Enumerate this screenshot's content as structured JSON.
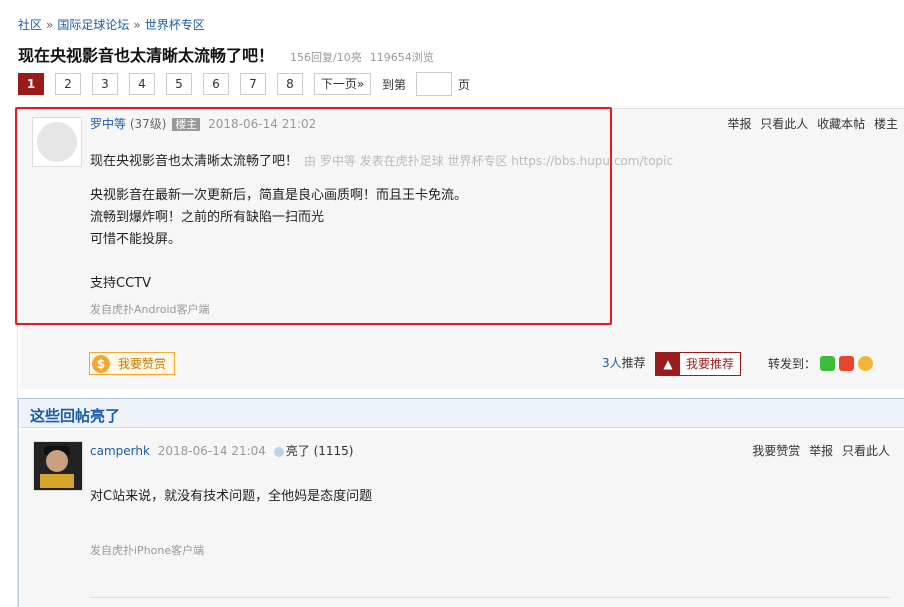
{
  "breadcrumb": {
    "items": [
      "社区",
      "国际足球论坛",
      "世界杯专区"
    ],
    "sep": "»"
  },
  "thread": {
    "title": "现在央视影音也太清晰太流畅了吧！",
    "replies": "156回复",
    "lights": "/10亮",
    "views": "119654浏览"
  },
  "pager": {
    "pages": [
      "1",
      "2",
      "3",
      "4",
      "5",
      "6",
      "7",
      "8"
    ],
    "next": "下一页»",
    "goto_prefix": "到第",
    "goto_suffix": "页"
  },
  "post": {
    "username": "罗中等",
    "level": "(37级)",
    "owner_badge": "楼主",
    "date": "2018-06-14 21:02",
    "actions": [
      "举报",
      "只看此人",
      "收藏本帖",
      "楼主"
    ],
    "headline": "现在央视影音也太清晰太流畅了吧！",
    "via": "由  罗中等 发表在虎扑足球 世界杯专区 https://bbs.hupu.com/topic",
    "lines": [
      "央视影音在最新一次更新后，简直是良心画质啊！而且王卡免流。",
      "流畅到爆炸啊！之前的所有缺陷一扫而光",
      "可惜不能投屏。",
      "",
      "支持CCTV"
    ],
    "source": "发自虎扑Android客户端",
    "tip_label": "我要赞赏",
    "tip_icon": "$",
    "recommend_count": "3人",
    "recommend_text": "推荐",
    "recommend_btn": "我要推荐",
    "share_label": "转发到："
  },
  "hot_replies": {
    "title": "这些回帖亮了",
    "reply": {
      "username": "camperhk",
      "date": "2018-06-14 21:04",
      "light_text": "亮了",
      "light_count": "(1115)",
      "actions": [
        "我要赞赏",
        "举报",
        "只看此人"
      ],
      "content": "对C站来说，就没有技术问题，全他妈是态度问题",
      "source": "发自虎扑iPhone客户端"
    }
  },
  "colors": {
    "accent": "#9a1b1b",
    "link": "#1a5ca8",
    "highlight": "#e6191e"
  }
}
